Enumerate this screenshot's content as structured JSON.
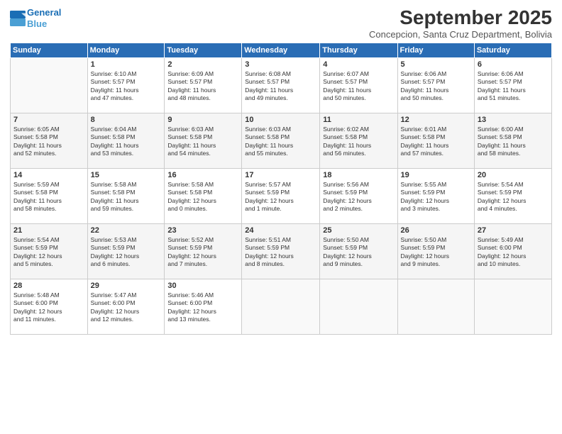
{
  "header": {
    "logo_line1": "General",
    "logo_line2": "Blue",
    "month_title": "September 2025",
    "location": "Concepcion, Santa Cruz Department, Bolivia"
  },
  "days_of_week": [
    "Sunday",
    "Monday",
    "Tuesday",
    "Wednesday",
    "Thursday",
    "Friday",
    "Saturday"
  ],
  "weeks": [
    [
      {
        "day": "",
        "info": ""
      },
      {
        "day": "1",
        "info": "Sunrise: 6:10 AM\nSunset: 5:57 PM\nDaylight: 11 hours\nand 47 minutes."
      },
      {
        "day": "2",
        "info": "Sunrise: 6:09 AM\nSunset: 5:57 PM\nDaylight: 11 hours\nand 48 minutes."
      },
      {
        "day": "3",
        "info": "Sunrise: 6:08 AM\nSunset: 5:57 PM\nDaylight: 11 hours\nand 49 minutes."
      },
      {
        "day": "4",
        "info": "Sunrise: 6:07 AM\nSunset: 5:57 PM\nDaylight: 11 hours\nand 50 minutes."
      },
      {
        "day": "5",
        "info": "Sunrise: 6:06 AM\nSunset: 5:57 PM\nDaylight: 11 hours\nand 50 minutes."
      },
      {
        "day": "6",
        "info": "Sunrise: 6:06 AM\nSunset: 5:57 PM\nDaylight: 11 hours\nand 51 minutes."
      }
    ],
    [
      {
        "day": "7",
        "info": "Sunrise: 6:05 AM\nSunset: 5:58 PM\nDaylight: 11 hours\nand 52 minutes."
      },
      {
        "day": "8",
        "info": "Sunrise: 6:04 AM\nSunset: 5:58 PM\nDaylight: 11 hours\nand 53 minutes."
      },
      {
        "day": "9",
        "info": "Sunrise: 6:03 AM\nSunset: 5:58 PM\nDaylight: 11 hours\nand 54 minutes."
      },
      {
        "day": "10",
        "info": "Sunrise: 6:03 AM\nSunset: 5:58 PM\nDaylight: 11 hours\nand 55 minutes."
      },
      {
        "day": "11",
        "info": "Sunrise: 6:02 AM\nSunset: 5:58 PM\nDaylight: 11 hours\nand 56 minutes."
      },
      {
        "day": "12",
        "info": "Sunrise: 6:01 AM\nSunset: 5:58 PM\nDaylight: 11 hours\nand 57 minutes."
      },
      {
        "day": "13",
        "info": "Sunrise: 6:00 AM\nSunset: 5:58 PM\nDaylight: 11 hours\nand 58 minutes."
      }
    ],
    [
      {
        "day": "14",
        "info": "Sunrise: 5:59 AM\nSunset: 5:58 PM\nDaylight: 11 hours\nand 58 minutes."
      },
      {
        "day": "15",
        "info": "Sunrise: 5:58 AM\nSunset: 5:58 PM\nDaylight: 11 hours\nand 59 minutes."
      },
      {
        "day": "16",
        "info": "Sunrise: 5:58 AM\nSunset: 5:58 PM\nDaylight: 12 hours\nand 0 minutes."
      },
      {
        "day": "17",
        "info": "Sunrise: 5:57 AM\nSunset: 5:59 PM\nDaylight: 12 hours\nand 1 minute."
      },
      {
        "day": "18",
        "info": "Sunrise: 5:56 AM\nSunset: 5:59 PM\nDaylight: 12 hours\nand 2 minutes."
      },
      {
        "day": "19",
        "info": "Sunrise: 5:55 AM\nSunset: 5:59 PM\nDaylight: 12 hours\nand 3 minutes."
      },
      {
        "day": "20",
        "info": "Sunrise: 5:54 AM\nSunset: 5:59 PM\nDaylight: 12 hours\nand 4 minutes."
      }
    ],
    [
      {
        "day": "21",
        "info": "Sunrise: 5:54 AM\nSunset: 5:59 PM\nDaylight: 12 hours\nand 5 minutes."
      },
      {
        "day": "22",
        "info": "Sunrise: 5:53 AM\nSunset: 5:59 PM\nDaylight: 12 hours\nand 6 minutes."
      },
      {
        "day": "23",
        "info": "Sunrise: 5:52 AM\nSunset: 5:59 PM\nDaylight: 12 hours\nand 7 minutes."
      },
      {
        "day": "24",
        "info": "Sunrise: 5:51 AM\nSunset: 5:59 PM\nDaylight: 12 hours\nand 8 minutes."
      },
      {
        "day": "25",
        "info": "Sunrise: 5:50 AM\nSunset: 5:59 PM\nDaylight: 12 hours\nand 9 minutes."
      },
      {
        "day": "26",
        "info": "Sunrise: 5:50 AM\nSunset: 5:59 PM\nDaylight: 12 hours\nand 9 minutes."
      },
      {
        "day": "27",
        "info": "Sunrise: 5:49 AM\nSunset: 6:00 PM\nDaylight: 12 hours\nand 10 minutes."
      }
    ],
    [
      {
        "day": "28",
        "info": "Sunrise: 5:48 AM\nSunset: 6:00 PM\nDaylight: 12 hours\nand 11 minutes."
      },
      {
        "day": "29",
        "info": "Sunrise: 5:47 AM\nSunset: 6:00 PM\nDaylight: 12 hours\nand 12 minutes."
      },
      {
        "day": "30",
        "info": "Sunrise: 5:46 AM\nSunset: 6:00 PM\nDaylight: 12 hours\nand 13 minutes."
      },
      {
        "day": "",
        "info": ""
      },
      {
        "day": "",
        "info": ""
      },
      {
        "day": "",
        "info": ""
      },
      {
        "day": "",
        "info": ""
      }
    ]
  ]
}
